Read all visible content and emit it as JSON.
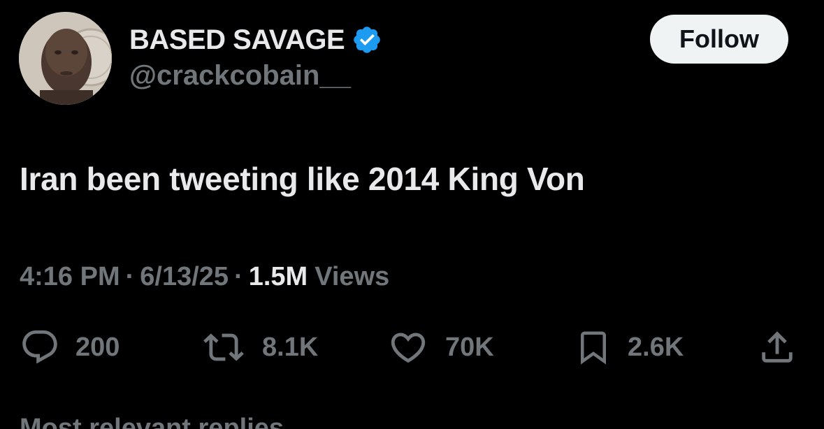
{
  "author": {
    "display_name": "BASED SAVAGE",
    "handle": "@crackcobain__",
    "verified": true
  },
  "follow_label": "Follow",
  "tweet": {
    "text": "Iran been tweeting like 2014 King Von"
  },
  "meta": {
    "time": "4:16 PM",
    "separator": "·",
    "date": "6/13/25",
    "views_count": "1.5M",
    "views_label": "Views"
  },
  "actions": {
    "replies": "200",
    "retweets": "8.1K",
    "likes": "70K",
    "bookmarks": "2.6K"
  },
  "replies_sort_label": "Most relevant replies",
  "colors": {
    "background": "#000000",
    "primary_text": "#e7e9ea",
    "secondary_text": "#71767b",
    "verified_blue": "#1d9bf0",
    "follow_bg": "#eff3f4"
  },
  "icons": {
    "verified": "verified-badge-icon",
    "reply": "reply-icon",
    "retweet": "retweet-icon",
    "like": "heart-icon",
    "bookmark": "bookmark-icon",
    "share": "share-icon"
  }
}
